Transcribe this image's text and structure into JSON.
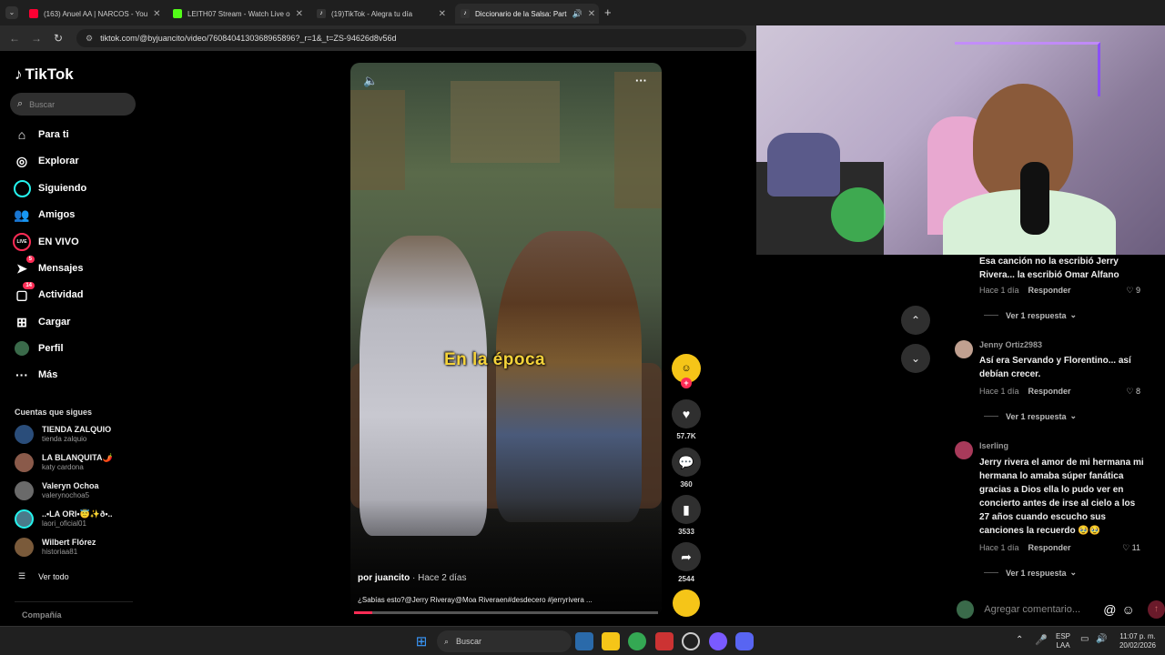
{
  "tabs": [
    {
      "title": "(163) Anuel AA | NARCOS - You",
      "color": "#ff0033"
    },
    {
      "title": "LEITH07 Stream - Watch Live o",
      "color": "#53fc18"
    },
    {
      "title": "(19)TikTok - Alegra tu día",
      "color": "#111111"
    },
    {
      "title": "Diccionario de la Salsa: Part",
      "color": "#111111"
    }
  ],
  "url": "tiktok.com/@byjuancito/video/7608404130368965896?_r=1&_t=ZS-94626d8v56d",
  "sidebar": {
    "logo": "TikTok",
    "search_placeholder": "Buscar",
    "nav": [
      {
        "label": "Para ti",
        "icon": "home-icon"
      },
      {
        "label": "Explorar",
        "icon": "compass-icon"
      },
      {
        "label": "Siguiendo",
        "icon": "following-icon"
      },
      {
        "label": "Amigos",
        "icon": "friends-icon"
      },
      {
        "label": "EN VIVO",
        "icon": "live-icon"
      },
      {
        "label": "Mensajes",
        "icon": "messages-icon",
        "badge": "5"
      },
      {
        "label": "Actividad",
        "icon": "activity-icon",
        "badge": "14"
      },
      {
        "label": "Cargar",
        "icon": "upload-icon"
      },
      {
        "label": "Perfil",
        "icon": "profile-icon"
      },
      {
        "label": "Más",
        "icon": "more-icon"
      }
    ],
    "following_title": "Cuentas que sigues",
    "accounts": [
      {
        "name": "TIENDA ZALQUIO",
        "handle": "tienda zalquio",
        "color": "#2a4d7a"
      },
      {
        "name": "LA BLANQUITA🌶️",
        "handle": "katy cardona",
        "color": "#8a5a4a"
      },
      {
        "name": "Valeryn Ochoa",
        "handle": "valerynochoa5",
        "color": "#6a6a6a"
      },
      {
        "name": "..•LA ORI•😇✨ð•..",
        "handle": "laori_oficial01",
        "color": "#4a7a8a"
      },
      {
        "name": "Wilbert Flórez",
        "handle": "historiaa81",
        "color": "#7a5a3a"
      }
    ],
    "see_all": "Ver todo",
    "company": "Compañía"
  },
  "video": {
    "caption": "En la época",
    "author": "por juancito",
    "time": " · Hace 2 días",
    "description": "¿Sabías esto?@Jerry Riveray@Moa Riveraen#desdecero #jerryrivera ..."
  },
  "actions": {
    "likes": "57.7K",
    "comments": "360",
    "saves": "3533",
    "shares": "2544"
  },
  "comments": [
    {
      "user": "",
      "text": "Esa canción no la escribió Jerry Rivera... la escribió Omar Alfano",
      "time": "Hace 1 día",
      "reply": "Responder",
      "likes": "9",
      "replies": "Ver 1 respuesta"
    },
    {
      "user": "Jenny Ortiz2983",
      "text": "Así era Servando y Florentino... así debían crecer.",
      "time": "Hace 1 día",
      "reply": "Responder",
      "likes": "8",
      "replies": "Ver 1 respuesta"
    },
    {
      "user": "Iserling",
      "text": "Jerry rivera el amor de mi hermana mi hermana lo amaba súper fanática gracias a Dios ella lo pudo ver en concierto antes de irse al cielo a los 27 años cuando escucho sus canciones la recuerdo 🥹🥹",
      "time": "Hace 1 día",
      "reply": "Responder",
      "likes": "11",
      "replies": "Ver 1 respuesta"
    }
  ],
  "comment_input_placeholder": "Agregar comentario...",
  "taskbar": {
    "search": "Buscar",
    "lang": "ESP",
    "lang2": "LAA",
    "time": "11:07 p. m.",
    "date": "20/02/2026"
  }
}
